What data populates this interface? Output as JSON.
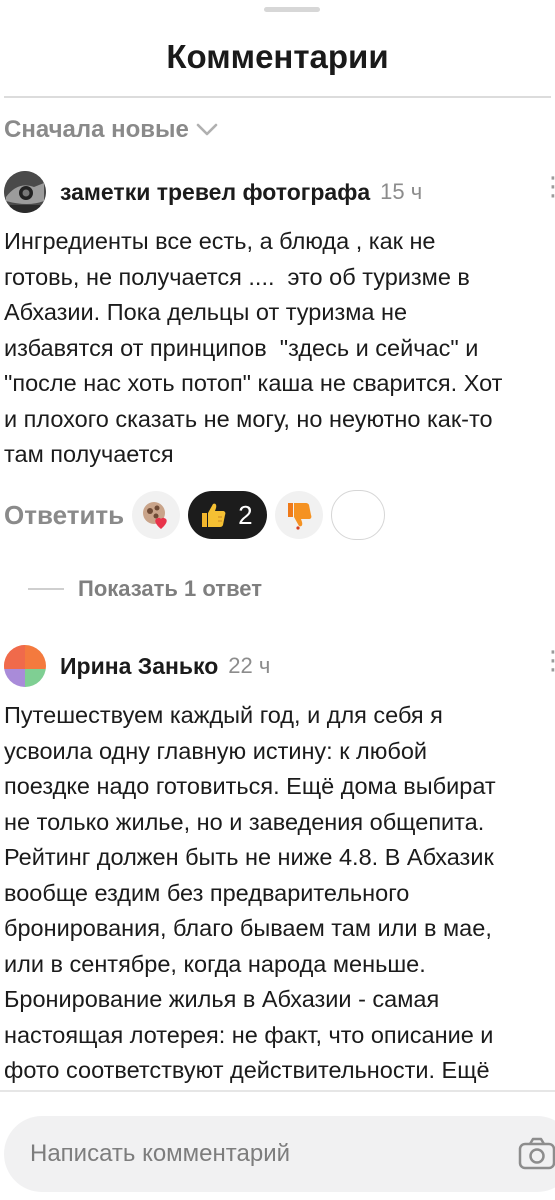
{
  "header": {
    "title": "Комментарии"
  },
  "sort": {
    "label": "Сначала новые",
    "icon": "chevron-down-icon"
  },
  "comments": [
    {
      "author": "заметки тревел фотографа",
      "time": "15 ч",
      "text": "Ингредиенты все есть, а блюда , как не\nготовь, не получается ....  это об туризме в\nАбхазии. Пока дельцы от туризма не\nизбавятся от принципов  \"здесь и сейчас\" и\n\"после нас хоть потоп\" каша не сварится. Хот\nи плохого сказать не могу, но неуютно как-то\nтам получается",
      "reply_label": "Ответить",
      "reactions": {
        "like_count": "2"
      },
      "show_replies_label": "Показать 1 ответ"
    },
    {
      "author": "Ирина Занько",
      "time": "22 ч",
      "text": "Путешествуем каждый год, и для себя я\nусвоила одну главную истину: к любой\nпоездке надо готовиться. Ещё дома выбират\nне только жилье, но и заведения общепита.\nРейтинг должен быть не ниже 4.8. В Абхазик\nвообще ездим без предварительного\nбронирования, благо бываем там или в мае,\nили в сентябре, когда народа меньше.\nБронирование жилья в Абхазии - самая\nнастоящая лотерея: не факт, что описание и\nфото соответствуют действительности. Ещё"
    }
  ],
  "composer": {
    "placeholder": "Написать комментарий",
    "icon": "camera-icon"
  },
  "colors": {
    "dark_chip": "#1c1c1c",
    "muted_text": "#8a8a8a",
    "input_bg": "#f1f1f2"
  }
}
